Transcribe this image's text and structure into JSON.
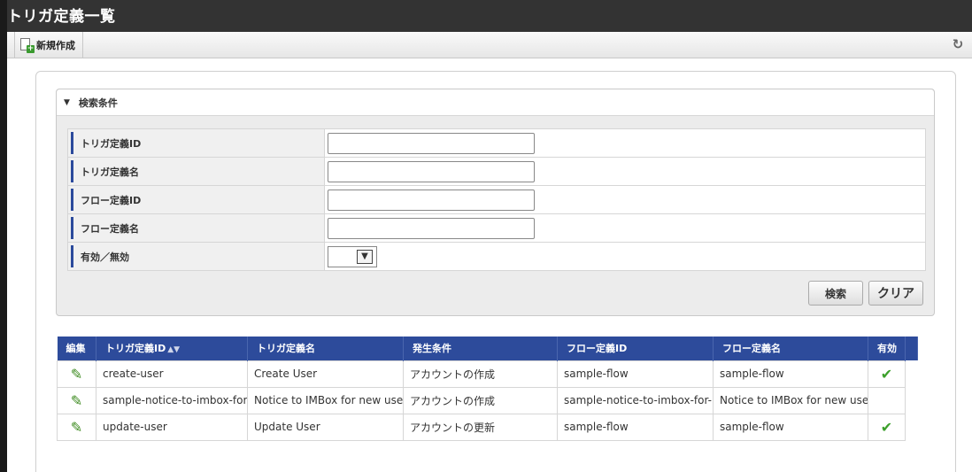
{
  "page": {
    "title": "トリガ定義一覧"
  },
  "toolbar": {
    "new_label": "新規作成",
    "refresh_icon": "refresh-icon"
  },
  "search": {
    "header": "検索条件",
    "fields": [
      {
        "label": "トリガ定義ID",
        "value": ""
      },
      {
        "label": "トリガ定義名",
        "value": ""
      },
      {
        "label": "フロー定義ID",
        "value": ""
      },
      {
        "label": "フロー定義名",
        "value": ""
      }
    ],
    "enabled_label": "有効／無効",
    "enabled_value": "",
    "search_button": "検索",
    "clear_button": "クリア"
  },
  "grid": {
    "headers": [
      "編集",
      "トリガ定義ID",
      "トリガ定義名",
      "発生条件",
      "フロー定義ID",
      "フロー定義名",
      "有効"
    ],
    "rows": [
      {
        "id": "create-user",
        "name": "Create User",
        "condition": "アカウントの作成",
        "flow_id": "sample-flow",
        "flow_name": "sample-flow",
        "enabled": true,
        "enabled_mark": "✔"
      },
      {
        "id": "sample-notice-to-imbox-for-new-user",
        "name": "Notice to IMBox for new user",
        "condition": "アカウントの作成",
        "flow_id": "sample-notice-to-imbox-for-new-user",
        "flow_name": "Notice to IMBox for new user",
        "enabled": false,
        "enabled_mark": ""
      },
      {
        "id": "update-user",
        "name": "Update User",
        "condition": "アカウントの更新",
        "flow_id": "sample-flow",
        "flow_name": "sample-flow",
        "enabled": true,
        "enabled_mark": "✔"
      }
    ]
  },
  "colors": {
    "header_bar": "#333333",
    "grid_header": "#2d4b9b",
    "accent_green": "#3c8a1f"
  }
}
